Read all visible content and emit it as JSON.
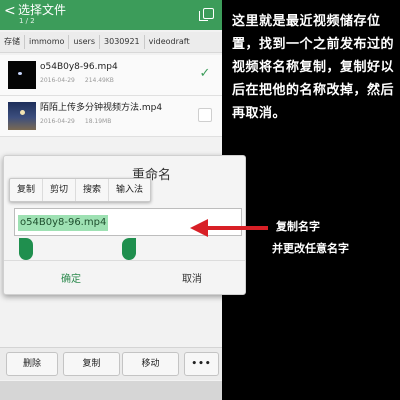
{
  "header": {
    "back_glyph": "<",
    "title": "选择文件",
    "subtitle": "1 / 2"
  },
  "breadcrumb": [
    "存储",
    "immomo",
    "users",
    "3030921",
    "videodraft"
  ],
  "files": [
    {
      "name": "o54B0y8-96.mp4",
      "date": "2016-04-29",
      "size": "214.49KB",
      "checked": true
    },
    {
      "name": "陌陌上传多分钟视频方法.mp4",
      "date": "2016-04-29",
      "size": "18.19MB",
      "checked": false
    }
  ],
  "dialog": {
    "title": "重命名",
    "context_menu": [
      "复制",
      "剪切",
      "搜索",
      "输入法"
    ],
    "input_value": "o54B0y8-96.mp4",
    "ok_label": "确定",
    "cancel_label": "取消"
  },
  "toolbar": {
    "delete_label": "删除",
    "copy_label": "复制",
    "move_label": "移动",
    "more_label": "•••"
  },
  "annotations": {
    "top": "这里就是最近视频储存位置，找到一个之前发布过的视频将名称复制，复制好以后在把他的名称改掉，然后再取消。",
    "side_line1": "复制名字",
    "side_line2": "并更改任意名字"
  },
  "colors": {
    "accent": "#3c9c5a",
    "selection": "#9ee1b3",
    "arrow": "#d81f26"
  }
}
